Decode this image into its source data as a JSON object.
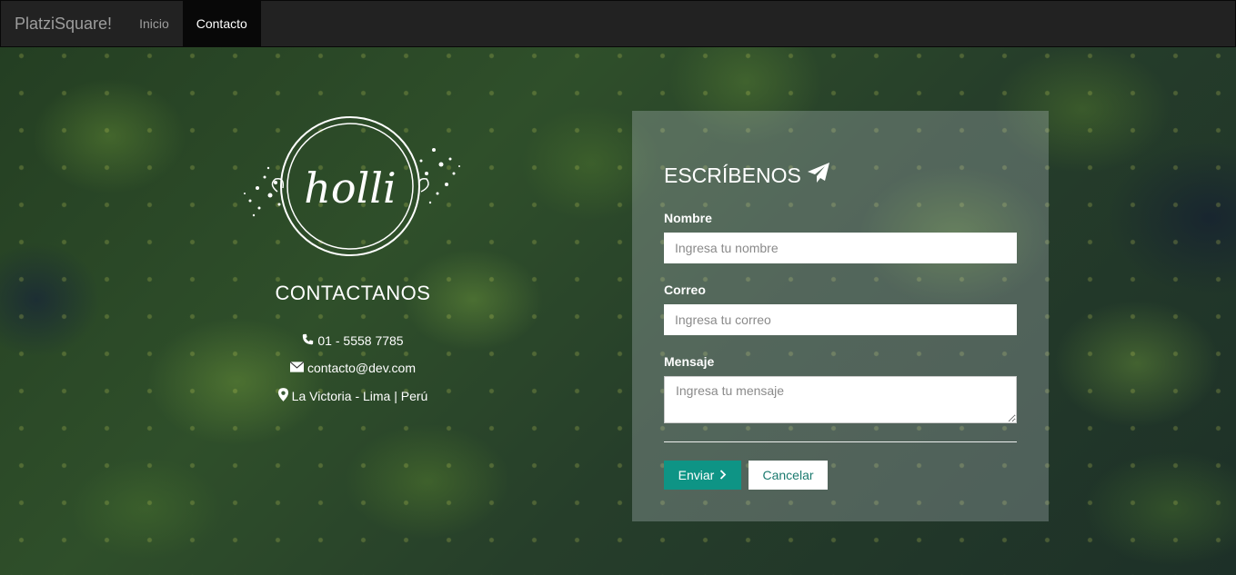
{
  "navbar": {
    "brand": "PlatziSquare!",
    "links": [
      {
        "label": "Inicio",
        "active": false
      },
      {
        "label": "Contacto",
        "active": true
      }
    ]
  },
  "logo": {
    "text": "holli"
  },
  "contact": {
    "title": "CONTACTANOS",
    "phone": "01 - 5558 7785",
    "email": "contacto@dev.com",
    "address": "La Victoria - Lima | Perú",
    "icons": [
      "phone-icon",
      "envelope-icon",
      "map-marker-icon"
    ]
  },
  "form": {
    "title": "ESCRÍBENOS",
    "title_icon": "paper-plane-icon",
    "name_label": "Nombre",
    "name_placeholder": "Ingresa tu nombre",
    "name_value": "",
    "email_label": "Correo",
    "email_placeholder": "Ingresa tu correo",
    "email_value": "",
    "message_label": "Mensaje",
    "message_placeholder": "Ingresa tu mensaje",
    "message_value": "",
    "send_label": "Enviar",
    "send_icon": "chevron-right-icon",
    "cancel_label": "Cancelar"
  },
  "colors": {
    "navbar_bg": "#222222",
    "active_link_bg": "#080808",
    "send_button": "#0e9485",
    "cancel_text": "#1b7a6f"
  }
}
